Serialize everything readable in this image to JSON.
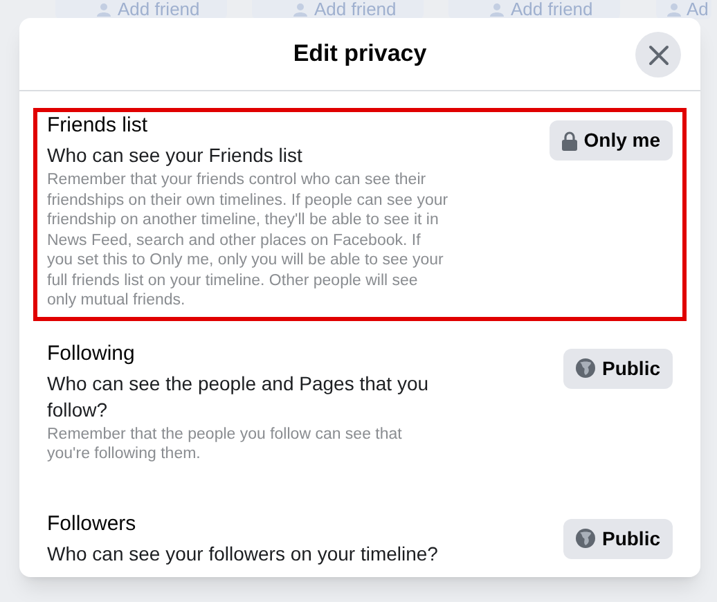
{
  "background": {
    "add_friend_buttons": [
      "Add friend",
      "Add friend",
      "Add friend",
      "Ad"
    ]
  },
  "dialog": {
    "title": "Edit privacy",
    "sections": [
      {
        "title": "Friends list",
        "question": "Who can see your Friends list",
        "note": "Remember that your friends control who can see their friendships on their own timelines. If people can see your friendship on another timeline, they'll be able to see it in News Feed, search and other places on Facebook. If you set this to Only me, only you will be able to see your full friends list on your timeline. Other people will see only mutual friends.",
        "highlighted": true,
        "audience": {
          "kind": "private",
          "label": "Only me"
        }
      },
      {
        "title": "Following",
        "question": "Who can see the people and Pages that you follow?",
        "note": "Remember that the people you follow can see that you're following them.",
        "highlighted": false,
        "audience": {
          "kind": "public",
          "label": "Public"
        }
      },
      {
        "title": "Followers",
        "question": "Who can see your followers on your timeline?",
        "highlighted": false,
        "audience": {
          "kind": "public",
          "label": "Public"
        }
      }
    ]
  }
}
